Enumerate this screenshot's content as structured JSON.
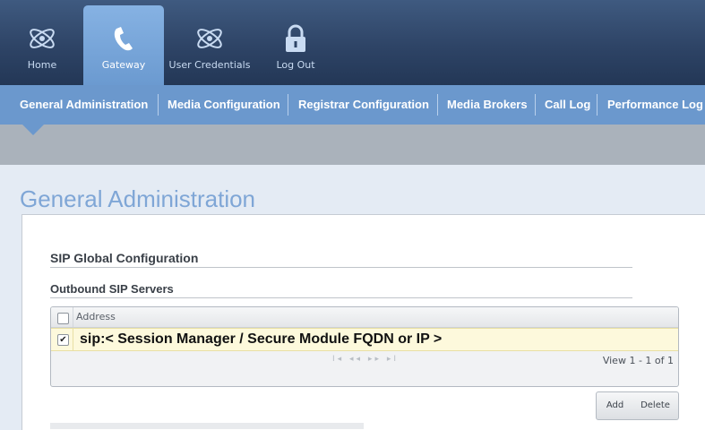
{
  "top_nav": {
    "items": [
      {
        "label": "Home",
        "icon": "atom-icon"
      },
      {
        "label": "Gateway",
        "icon": "phone-icon",
        "active": true
      },
      {
        "label": "User Credentials",
        "icon": "atom-icon"
      },
      {
        "label": "Log Out",
        "icon": "lock-icon"
      }
    ]
  },
  "sub_nav": {
    "tabs": [
      {
        "label": "General Administration",
        "active": true
      },
      {
        "label": "Media Configuration"
      },
      {
        "label": "Registrar Configuration"
      },
      {
        "label": "Media Brokers"
      },
      {
        "label": "Call Log"
      },
      {
        "label": "Performance Log"
      }
    ]
  },
  "page": {
    "title": "General Administration",
    "section_title": "SIP Global Configuration",
    "subsection_title": "Outbound SIP Servers"
  },
  "grid": {
    "column_header": "Address",
    "rows": [
      {
        "checked": true,
        "address": "sip:< Session Manager / Secure Module FQDN or IP >"
      }
    ],
    "pager_symbols": "I◂ ◂◂ ▸▸ ▸I",
    "view_text": "View 1 - 1 of 1"
  },
  "buttons": {
    "add_label": "Add",
    "delete_label": "Delete"
  },
  "colors": {
    "top_bar": "#2e4466",
    "active_tab": "#6b9ad0",
    "sub_nav": "#6b98cd",
    "page_title": "#7fa6d6",
    "selected_row": "#fdf9dc"
  }
}
